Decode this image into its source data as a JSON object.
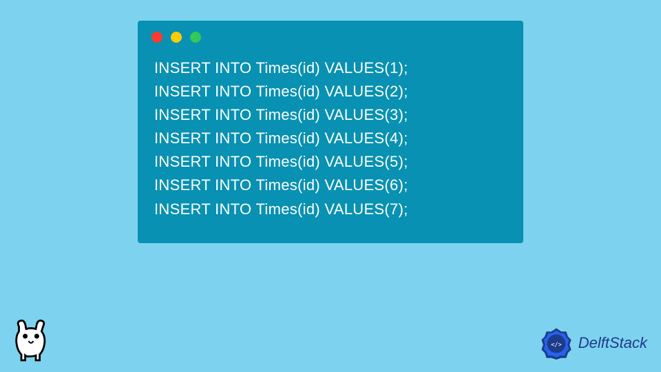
{
  "code": {
    "lines": [
      "INSERT INTO Times(id) VALUES(1);",
      "INSERT INTO Times(id) VALUES(2);",
      "INSERT INTO Times(id) VALUES(3);",
      "INSERT INTO Times(id) VALUES(4);",
      "INSERT INTO Times(id) VALUES(5);",
      "INSERT INTO Times(id) VALUES(6);",
      "INSERT INTO Times(id) VALUES(7);"
    ]
  },
  "branding": {
    "name": "DelftStack"
  },
  "colors": {
    "background": "#7dd3ef",
    "codeWindow": "#0891b2",
    "codeText": "#ffffff",
    "brandText": "#1e3a8a"
  }
}
